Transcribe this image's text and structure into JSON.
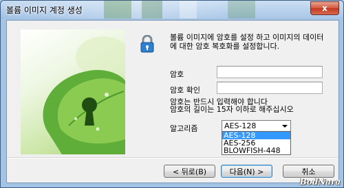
{
  "window": {
    "title": "볼륨 이미지 계정 생성",
    "close_glyph": "x"
  },
  "header": {
    "description": "볼륨 이미지에 암호를 설정 하고 이미지의 데이터에 대한 암호 복호화를 설정합니다.",
    "icon": "lock-icon"
  },
  "form": {
    "password_label": "암호",
    "password_value": "",
    "confirm_label": "암호 확인",
    "confirm_value": "",
    "note": "암호는 반드시 입력해야 합니다\n암호의 길이는 15자 이하로 해주십시오",
    "algorithm_label": "알고리즘",
    "algorithm_selected": "AES-128",
    "algorithm_options": [
      "AES-128",
      "AES-256",
      "BLOWFISH-448"
    ]
  },
  "buttons": {
    "back": "< 뒤로(B)",
    "next": "다음(N) >",
    "cancel": "취소"
  },
  "watermark": "BodNara",
  "colors": {
    "accent": "#3399ff",
    "titlebar": "#a4c4e6",
    "close": "#c0381f"
  }
}
